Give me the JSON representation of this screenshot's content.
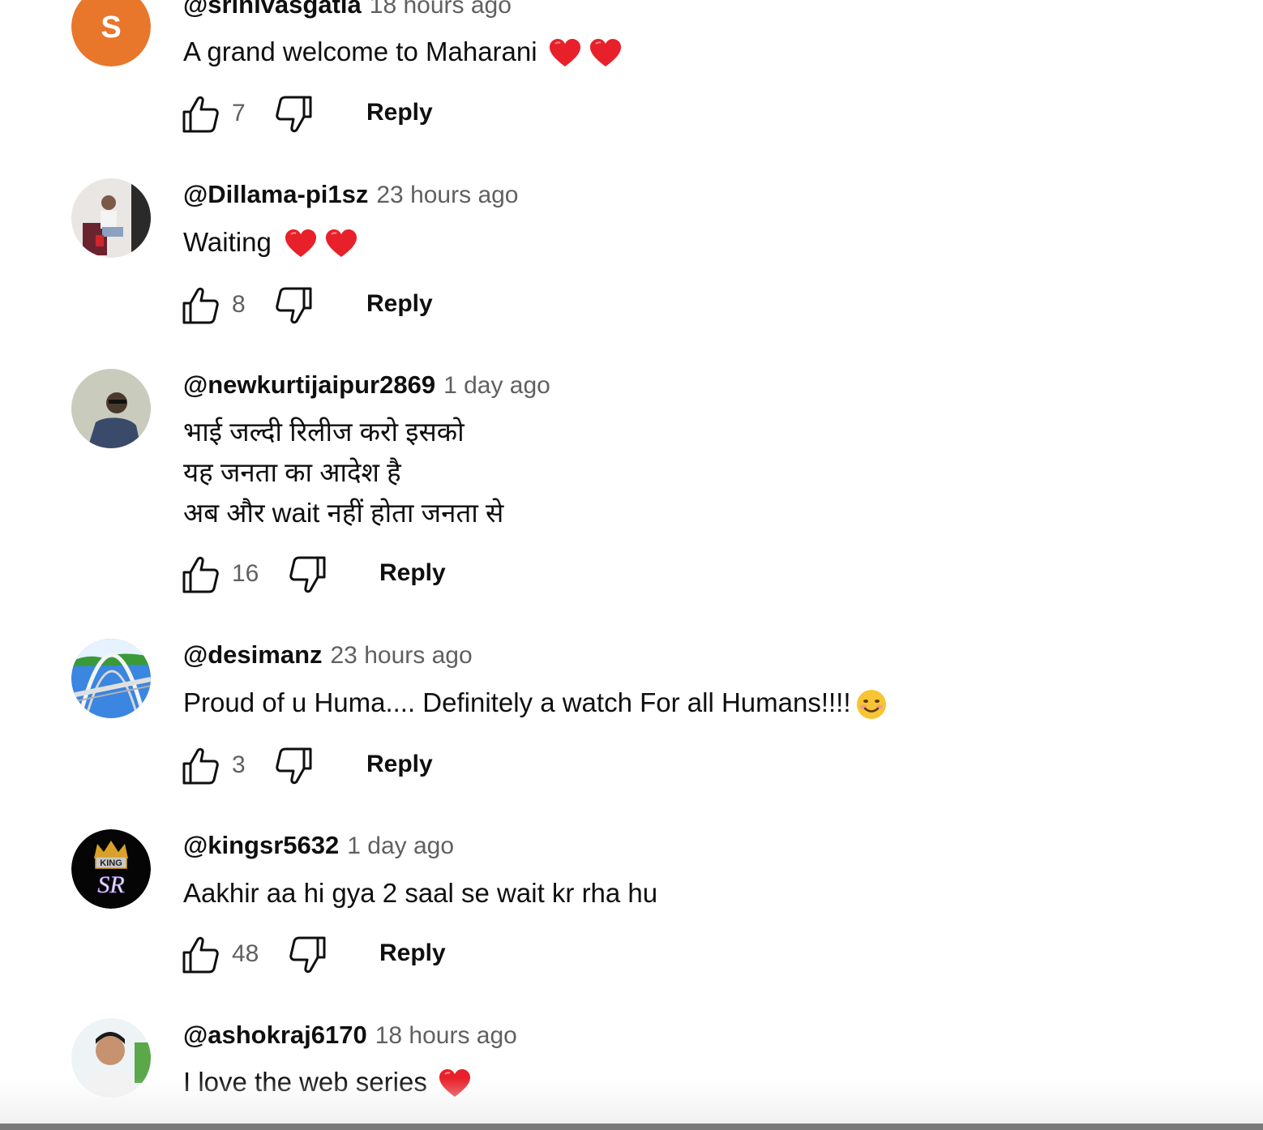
{
  "colors": {
    "heart": "#e8202a",
    "orange_avatar": "#e8762b",
    "text": "#0f0f0f",
    "muted": "#606060"
  },
  "comments": [
    {
      "handle": "@srinivasgatla",
      "time": "18 hours ago",
      "avatar_letter": "S",
      "lines": [
        "A grand welcome to Maharani"
      ],
      "likes": "7",
      "reply": "Reply"
    },
    {
      "handle": "@Dillama-pi1sz",
      "time": "23 hours ago",
      "lines": [
        "Waiting"
      ],
      "likes": "8",
      "reply": "Reply"
    },
    {
      "handle": "@newkurtijaipur2869",
      "time": "1 day ago",
      "lines": [
        "भाई जल्दी रिलीज करो इसको",
        "यह जनता का आदेश है",
        "अब और wait नहीं होता जनता से"
      ],
      "likes": "16",
      "reply": "Reply"
    },
    {
      "handle": "@desimanz",
      "time": "23 hours ago",
      "lines": [
        "Proud of u Huma.... Definitely a watch For all Humans!!!!"
      ],
      "likes": "3",
      "reply": "Reply"
    },
    {
      "handle": "@kingsr5632",
      "time": "1 day ago",
      "avatar_text": [
        "KING",
        "SR"
      ],
      "lines": [
        "Aakhir aa hi gya 2 saal se wait kr rha hu"
      ],
      "likes": "48",
      "reply": "Reply"
    },
    {
      "handle": "@ashokraj6170",
      "time": "18 hours ago",
      "lines": [
        "I love the web series"
      ]
    }
  ]
}
